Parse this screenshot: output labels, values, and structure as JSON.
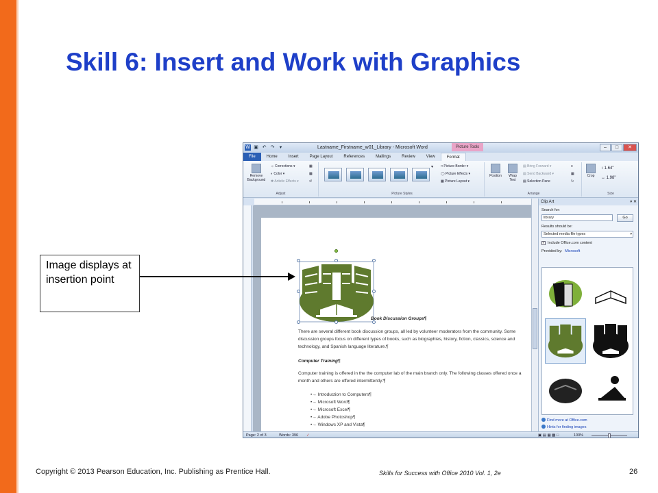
{
  "slide": {
    "title": "Skill 6: Insert and Work with Graphics",
    "callout_text": "Image displays at insertion point",
    "footer_left": "Copyright © 2013 Pearson Education, Inc. Publishing as Prentice Hall.",
    "footer_center": "Skills for Success with Office 2010 Vol. 1, 2e",
    "page_number": "26",
    "accent_color": "#f26a1b",
    "title_color": "#1e3fc8"
  },
  "word": {
    "window_title": "Lastname_Firstname_w01_Library - Microsoft Word",
    "contextual_tab": "Picture Tools",
    "tabs": [
      "File",
      "Home",
      "Insert",
      "Page Layout",
      "References",
      "Mailings",
      "Review",
      "View",
      "Format"
    ],
    "active_tab": "Format",
    "ribbon": {
      "remove_background": "Remove Background",
      "corrections": "Corrections",
      "color": "Color",
      "artistic_effects": "Artistic Effects",
      "adjust_label": "Adjust",
      "picture_border": "Picture Border",
      "picture_effects": "Picture Effects",
      "picture_layout": "Picture Layout",
      "picture_styles_label": "Picture Styles",
      "position": "Position",
      "wrap_text": "Wrap Text",
      "bring_forward": "Bring Forward",
      "send_backward": "Send Backward",
      "selection_pane": "Selection Pane",
      "arrange_label": "Arrange",
      "crop": "Crop",
      "height": "1.64\"",
      "width": "1.98\"",
      "size_label": "Size"
    },
    "document": {
      "heading1": "Book Discussion Groups¶",
      "para1": "There are several different book discussion groups, all led by volunteer moderators from the community. Some discussion groups focus on different types of books, such as biographies, history, fiction, classics, science and technology, and Spanish language literature.¶",
      "heading2": "Computer Training¶",
      "para2": "Computer training is offered in the the computer lab of the main branch only. The following classes offered once a month and others are offered intermittently:¶",
      "list": [
        "Introduction to Computers¶",
        "Microsoft Word¶",
        "Microsoft Excel¶",
        "Adobe Photoshop¶",
        "Windows XP and Vista¶"
      ]
    },
    "clipart_pane": {
      "title": "Clip Art",
      "search_label": "Search for:",
      "search_value": "library",
      "go": "Go",
      "results_label": "Results should be:",
      "results_value": "Selected media file types",
      "include_office": "Include Office.com content",
      "provided_by_label": "Provided by:",
      "provided_by_value": "Microsoft",
      "find_more": "Find more at Office.com",
      "hints": "Hints for finding images"
    },
    "status": {
      "page": "Page: 2 of 3",
      "words": "Words: 396",
      "zoom": "100%"
    }
  }
}
